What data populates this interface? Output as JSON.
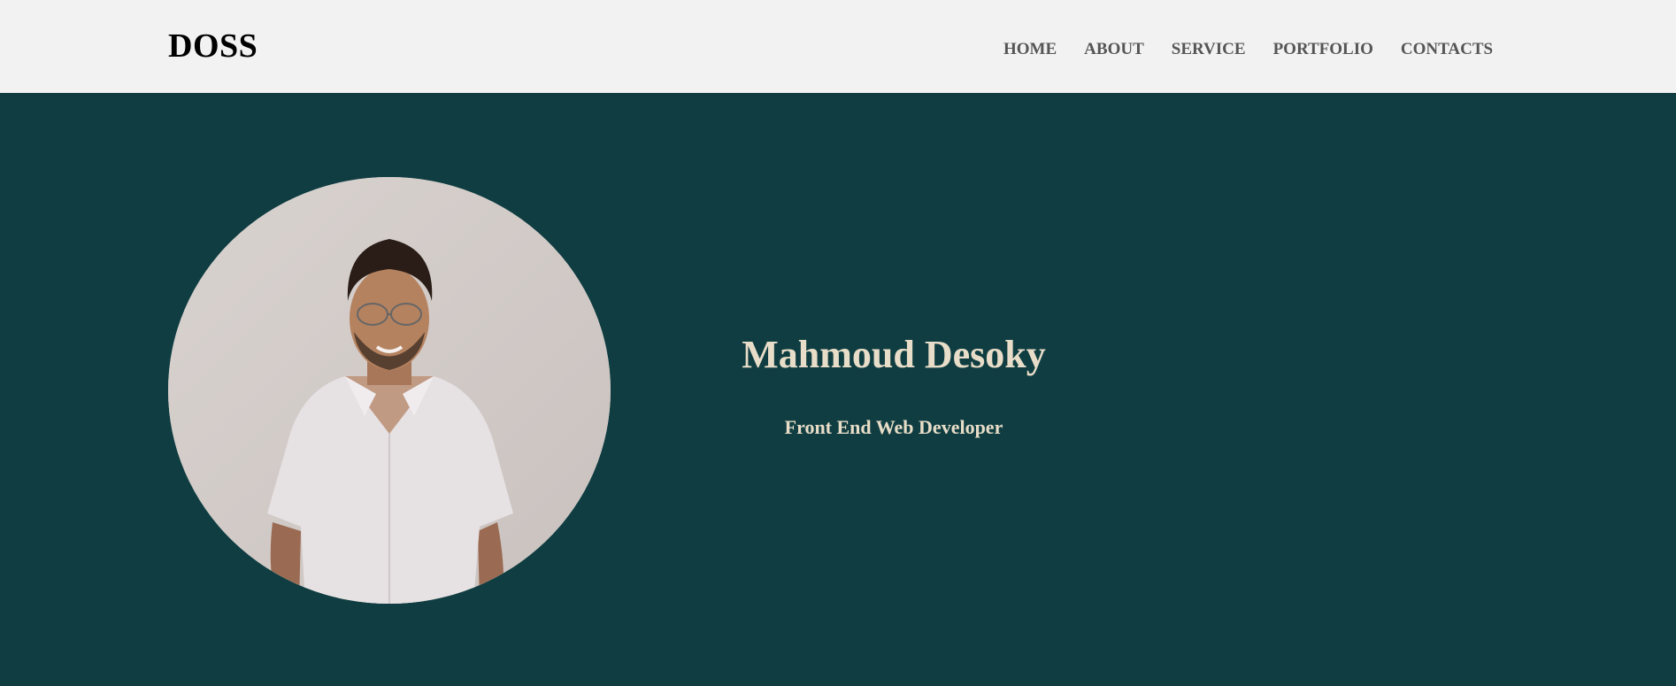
{
  "brand": {
    "logo_text": "DOSS"
  },
  "nav": {
    "items": [
      {
        "label": "HOME"
      },
      {
        "label": "ABOUT"
      },
      {
        "label": "SERVICE"
      },
      {
        "label": "PORTFOLIO"
      },
      {
        "label": "CONTACTS"
      }
    ]
  },
  "hero": {
    "name": "Mahmoud Desoky",
    "role": "Front End Web Developer",
    "photo_icon": "portrait-photo"
  },
  "colors": {
    "navbar_bg": "#f2f2f2",
    "hero_bg": "#0f3d41",
    "hero_text": "#e8ddc8",
    "nav_text": "#555555",
    "brand_text": "#000000"
  }
}
